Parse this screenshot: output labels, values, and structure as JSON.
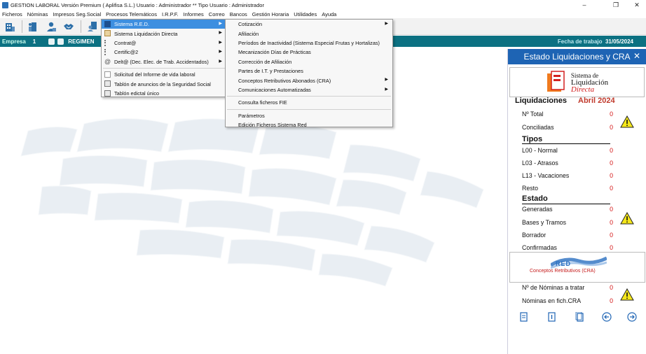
{
  "window": {
    "title": "GESTION LABORAL Versión Premium ( Aplifisa S.L.)    Usuario : Administrador  **  Tipo Usuario : Administrador",
    "controls": [
      "minimize-icon",
      "maximize-icon",
      "close-icon"
    ]
  },
  "menubar": [
    "Ficheros",
    "Nóminas",
    "Impresos Seg.Social",
    "Procesos Telemáticos",
    "I.R.P.F.",
    "Informes",
    "Correo",
    "Bancos",
    "Gestión Horaria",
    "Utilidades",
    "Ayuda"
  ],
  "empresa": {
    "label": "Empresa",
    "number": "1",
    "regimen": "REGIMEN",
    "fecha_label": "Fecha de trabajo",
    "fecha": "31/05/2024"
  },
  "menu1": {
    "items": [
      {
        "label": "Sistema R.E.D.",
        "submenu": true,
        "selected": true
      },
      {
        "label": "Sistema Liquidación Directa",
        "submenu": true
      },
      {
        "label": "Contrat@",
        "submenu": true
      },
      {
        "label": "Certific@2",
        "submenu": true
      },
      {
        "label": "Delt@ (Dec. Elec. de Trab. Accidentados)",
        "submenu": true
      },
      {
        "label": "Solicitud del Informe de vida laboral"
      },
      {
        "label": "Tablón de anuncios de la Seguridad Social"
      },
      {
        "label": "Tablón edictal único"
      }
    ]
  },
  "menu2": {
    "items": [
      {
        "label": "Cotización",
        "submenu": true
      },
      {
        "label": "Afiliación"
      },
      {
        "label": "Períodos de Inactividad (Sistema Especial Frutas y Hortalizas)"
      },
      {
        "label": "Mecanización Días de Prácticas"
      },
      {
        "label": "Corrección de Afiliación"
      },
      {
        "label": "Partes de I.T. y Prestaciones"
      },
      {
        "label": "Conceptos Retributivos Abonados (CRA)",
        "submenu": true
      },
      {
        "label": "Comunicaciones Automatizadas",
        "submenu": true
      },
      {
        "label": "Consulta ficheros FIE"
      },
      {
        "label": "Parámetros"
      },
      {
        "label": "Edición Ficheros Sistema Red"
      }
    ]
  },
  "panel": {
    "title": "Estado Liquidaciones y CRA",
    "logo": {
      "line1": "Sistema de",
      "line2": "Liquidación",
      "line3": "Directa"
    },
    "liquidaciones_title": "Liquidaciones",
    "period": "Abril 2024",
    "rows": [
      {
        "label": "Nº Total",
        "value": "0"
      },
      {
        "label": "Conciliadas",
        "value": "0"
      }
    ],
    "tipos_title": "Tipos",
    "tipos": [
      {
        "label": "L00 - Normal",
        "value": "0"
      },
      {
        "label": "L03 - Atrasos",
        "value": "0"
      },
      {
        "label": "L13 - Vacaciones",
        "value": "0"
      },
      {
        "label": "Resto",
        "value": "0"
      }
    ],
    "estado_title": "Estado",
    "estado": [
      {
        "label": "Generadas",
        "value": "0"
      },
      {
        "label": "Bases y Tramos",
        "value": "0"
      },
      {
        "label": "Borrador",
        "value": "0"
      },
      {
        "label": "Confirmadas",
        "value": "0"
      }
    ],
    "red_logo": {
      "word": "RED",
      "subtitle": "Conceptos Retributivos (CRA)"
    },
    "cra": [
      {
        "label": "Nº de Nóminas a tratar",
        "value": "0"
      },
      {
        "label": "Nóminas en fich.CRA",
        "value": "0"
      }
    ],
    "colors": {
      "header": "#1e64b4",
      "value": "#d31010",
      "period": "#c0392b"
    }
  }
}
